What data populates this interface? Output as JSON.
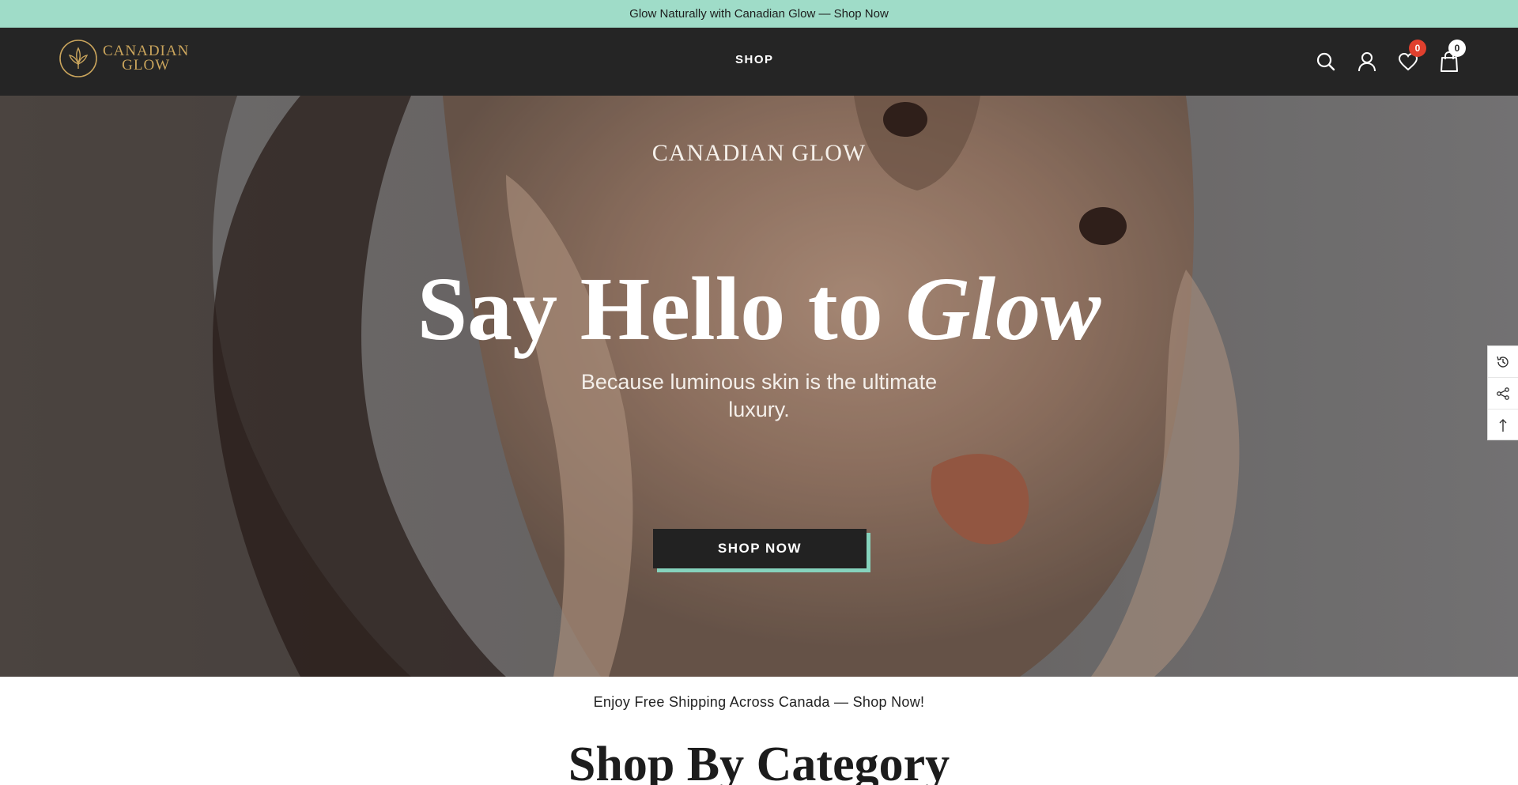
{
  "announcement": {
    "text": "Glow Naturally with Canadian Glow — Shop Now"
  },
  "header": {
    "logo": {
      "line1": "CANADIAN",
      "line2": "GLOW"
    },
    "nav": {
      "shop_label": "SHOP"
    },
    "icons": [
      "search-icon",
      "user-icon",
      "heart-icon",
      "cart-icon"
    ],
    "wishlist_count": "0",
    "cart_count": "0",
    "colors": {
      "background": "#252525",
      "logo": "#c9a45c",
      "wishlist_badge": "#e0402e"
    }
  },
  "hero": {
    "brand": "CANADIAN GLOW",
    "title_regular": "Say Hello to ",
    "title_italic": "Glow",
    "subtitle": "Because luminous skin is the ultimate luxury.",
    "button_label": "SHOP NOW",
    "colors": {
      "button_bg": "#222222",
      "button_accent": "#86d3bd"
    }
  },
  "side_tools": [
    "recently-viewed-icon",
    "share-icon",
    "back-to-top-icon"
  ],
  "shipping": {
    "text": "Enjoy Free Shipping Across Canada — Shop Now!"
  },
  "section": {
    "heading": "Shop By Category"
  },
  "colors": {
    "announcement_bg": "#9fdcc8"
  }
}
